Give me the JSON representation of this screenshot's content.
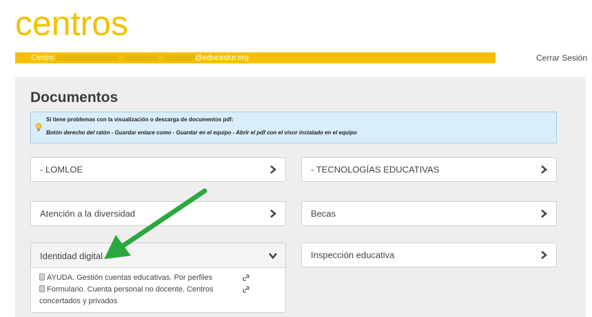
{
  "header": {
    "logo_text": "centros",
    "user_prefix": "Centro",
    "user_email_suffix": "@educastur.org",
    "logout_label": "Cerrar Sesión"
  },
  "page": {
    "title": "Documentos"
  },
  "info_box": {
    "line1": "Si tiene problemas con la visualización o descarga de documentos pdf:",
    "line2": "Botón derecho del ratón - Guardar enlace como - Guardar en el equipo - Abrir el pdf con el visor instalado en el equipo"
  },
  "panels": {
    "lomloe": "- LOMLOE",
    "tecnologias": "- TECNOLOGÍAS EDUCATIVAS",
    "atencion": "Atención a la diversidad",
    "becas": "Becas",
    "identidad": "Identidad digital",
    "inspeccion": "Inspección educativa"
  },
  "identidad_docs": [
    {
      "text": "AYUDA. Gestión cuentas educativas. Por perfiles"
    },
    {
      "text": "Formulario. Cuenta personal no docente. Centros concertados y privados"
    }
  ],
  "colors": {
    "brand_yellow": "#f5c000",
    "annotation_arrow": "#2aa83f",
    "info_bg": "#d9eefa"
  },
  "icons": [
    "lightbulb-icon",
    "chevron-right-icon",
    "chevron-down-icon",
    "document-icon",
    "link-icon"
  ]
}
